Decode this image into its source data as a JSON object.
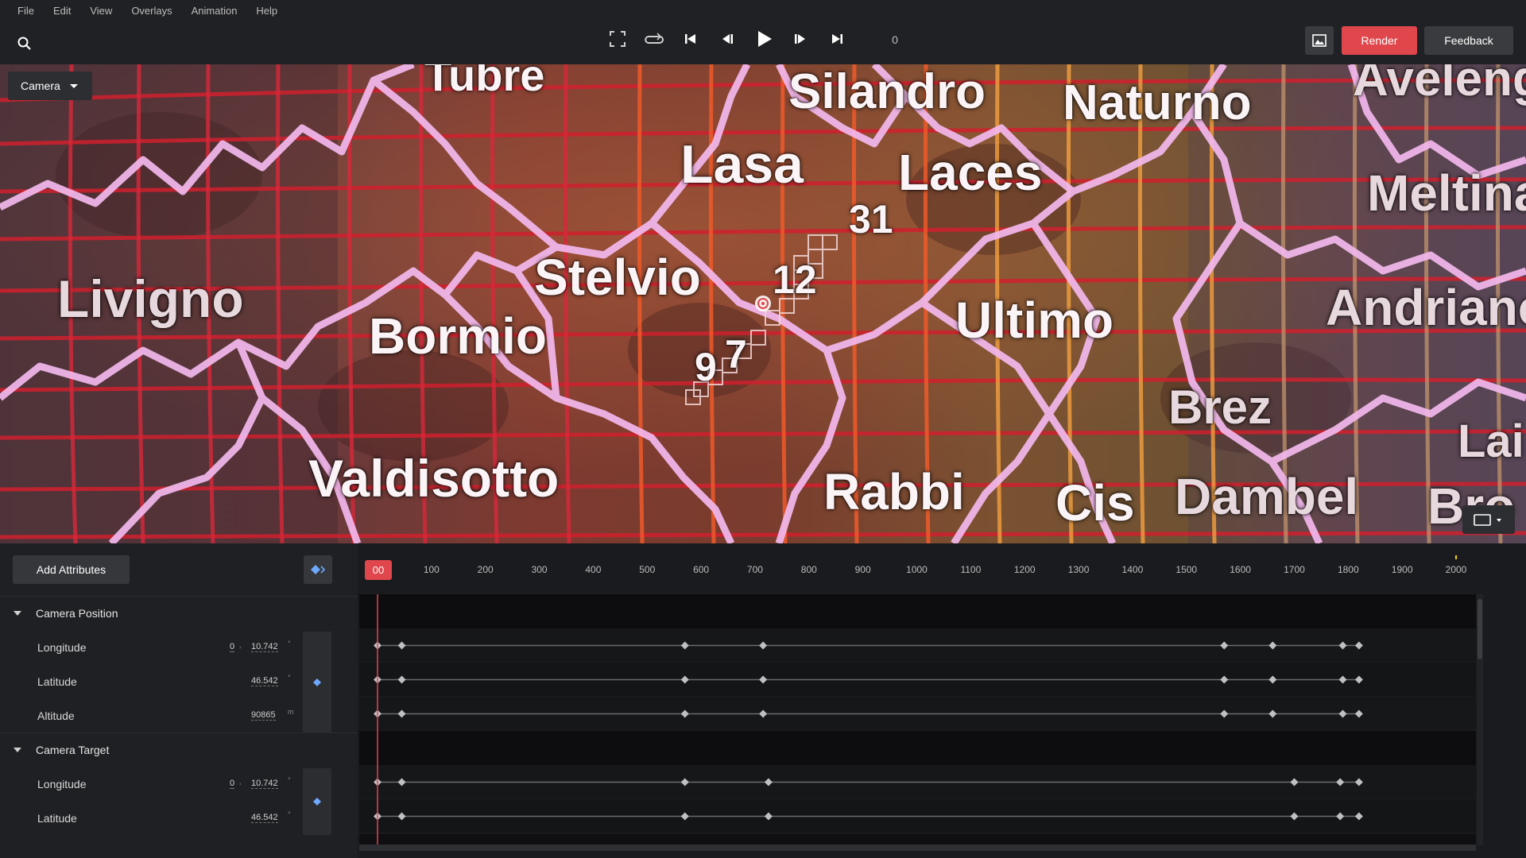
{
  "menu": [
    "File",
    "Edit",
    "View",
    "Overlays",
    "Animation",
    "Help"
  ],
  "transport": {
    "frame": "0"
  },
  "toolbar": {
    "render_label": "Render",
    "feedback_label": "Feedback"
  },
  "map": {
    "camera_label": "Camera",
    "places": [
      {
        "name": "Tubre",
        "faded": false
      },
      {
        "name": "Silandro",
        "faded": false
      },
      {
        "name": "Naturno",
        "faded": false
      },
      {
        "name": "Avelengo",
        "faded": true
      },
      {
        "name": "Lasa",
        "faded": false
      },
      {
        "name": "Laces",
        "faded": false
      },
      {
        "name": "Meltina",
        "faded": true
      },
      {
        "name": "31",
        "faded": false
      },
      {
        "name": "Livigno",
        "faded": true
      },
      {
        "name": "Stelvio",
        "faded": false
      },
      {
        "name": "12",
        "faded": false
      },
      {
        "name": "Andriano",
        "faded": true
      },
      {
        "name": "Bormio",
        "faded": false
      },
      {
        "name": "Ultimo",
        "faded": false
      },
      {
        "name": "9",
        "faded": false
      },
      {
        "name": "7",
        "faded": false
      },
      {
        "name": "Brez",
        "faded": true
      },
      {
        "name": "Lai",
        "faded": true
      },
      {
        "name": "Valdisotto",
        "faded": false
      },
      {
        "name": "Rabbi",
        "faded": false
      },
      {
        "name": "Cis",
        "faded": false
      },
      {
        "name": "Dambel",
        "faded": true
      },
      {
        "name": "Bro",
        "faded": true
      }
    ]
  },
  "timeline": {
    "add_attributes_label": "Add Attributes",
    "playhead_label": "00",
    "ruler_ticks": [
      "100",
      "200",
      "300",
      "400",
      "500",
      "600",
      "700",
      "800",
      "900",
      "1000",
      "1100",
      "1200",
      "1300",
      "1400",
      "1500",
      "1600",
      "1700",
      "1800",
      "1900",
      "2000"
    ],
    "ruler_max": 2000,
    "groups": [
      {
        "label": "Camera Position",
        "attributes": [
          {
            "name": "Longitude",
            "offset": "0",
            "value": "10.742",
            "unit": "°"
          },
          {
            "name": "Latitude",
            "offset": "",
            "value": "46.542",
            "unit": "°"
          },
          {
            "name": "Altitude",
            "offset": "",
            "value": "90865",
            "unit": "m"
          }
        ]
      },
      {
        "label": "Camera Target",
        "attributes": [
          {
            "name": "Longitude",
            "offset": "0",
            "value": "10.742",
            "unit": "°"
          },
          {
            "name": "Latitude",
            "offset": "",
            "value": "46.542",
            "unit": "°"
          }
        ]
      }
    ],
    "keyframes": {
      "camera_position": [
        0,
        45,
        570,
        715,
        1570,
        1660,
        1790,
        1820
      ],
      "camera_target": [
        0,
        45,
        570,
        725,
        1700,
        1785,
        1820
      ]
    }
  }
}
